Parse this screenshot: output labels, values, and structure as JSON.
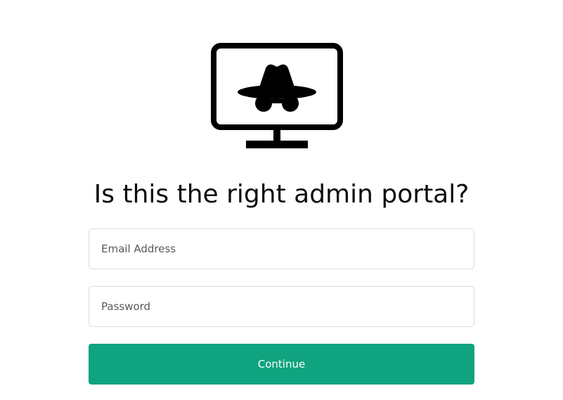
{
  "logo": {
    "icon": "incognito-monitor-icon"
  },
  "heading": "Is this the right admin portal?",
  "form": {
    "email_placeholder": "Email Address",
    "email_value": "",
    "password_placeholder": "Password",
    "password_value": "",
    "continue_label": "Continue"
  },
  "colors": {
    "primary": "#10a37f",
    "border": "#dcdcdc",
    "text": "#0d0d0d"
  }
}
